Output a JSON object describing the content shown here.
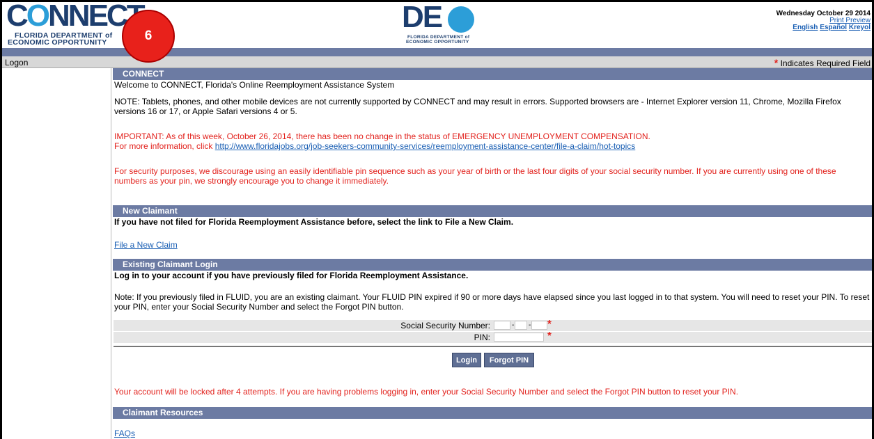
{
  "header": {
    "connect_logo": {
      "word_pre": "C",
      "word_o": "O",
      "word_post": "NNECT",
      "sub1": "FLORIDA DEPARTMENT of",
      "sub2": "ECONOMIC OPPORTUNITY"
    },
    "step_badge": "6",
    "deo_logo": {
      "word": "DE",
      "sub1": "FLORIDA DEPARTMENT of",
      "sub2": "ECONOMIC OPPORTUNITY"
    },
    "date": "Wednesday October 29 2014",
    "print_preview": "Print Preview",
    "languages": [
      "English",
      "Español",
      "Kreyol"
    ]
  },
  "logon_bar": {
    "label": "Logon",
    "required_star": "*",
    "required_text": "Indicates Required Field"
  },
  "connect_section": {
    "title": "CONNECT",
    "welcome": "Welcome to CONNECT, Florida's Online Reemployment Assistance System",
    "note": "NOTE: Tablets, phones, and other mobile devices are not currently supported by CONNECT and may result in errors. Supported browsers are - Internet Explorer version 11, Chrome, Mozilla Firefox versions 16 or 17, or Apple Safari versions 4 or 5.",
    "important_line1": "IMPORTANT: As of this week, October 26, 2014, there has been no change in the status of EMERGENCY UNEMPLOYMENT COMPENSATION.",
    "important_line2_prefix": "For more information, click ",
    "important_link": "http://www.floridajobs.org/job-seekers-community-services/reemployment-assistance-center/file-a-claim/hot-topics",
    "security": "For security purposes, we discourage using an easily identifiable pin sequence such as your year of birth or the last four digits of your social security number. If you are currently using one of these numbers as your pin, we strongly encourage you to change it immediately."
  },
  "new_claimant": {
    "title": "New Claimant",
    "instruction": "If you have not filed for Florida Reemployment Assistance before, select the link to File a New Claim.",
    "link": "File a New Claim"
  },
  "existing_login": {
    "title": "Existing Claimant Login",
    "instruction": "Log in to your account if you have previously filed for Florida Reemployment Assistance.",
    "note": "Note: If you previously filed in FLUID, you are an existing claimant. Your FLUID PIN expired if 90 or more days have elapsed since you last logged in to that system. You will need to reset your PIN. To reset your PIN, enter your Social Security Number and select the Forgot PIN button.",
    "ssn_label": "Social Security Number:",
    "pin_label": "PIN:",
    "ssn_values": [
      "",
      "",
      ""
    ],
    "pin_value": "",
    "star": "*",
    "dash": "-",
    "login_button": "Login",
    "forgot_button": "Forgot PIN",
    "lock_warning": "Your account will be locked after 4 attempts. If you are having problems logging in, enter your Social Security Number and select the Forgot PIN button to reset your PIN."
  },
  "resources": {
    "title": "Claimant Resources",
    "faq_link": "FAQs"
  }
}
